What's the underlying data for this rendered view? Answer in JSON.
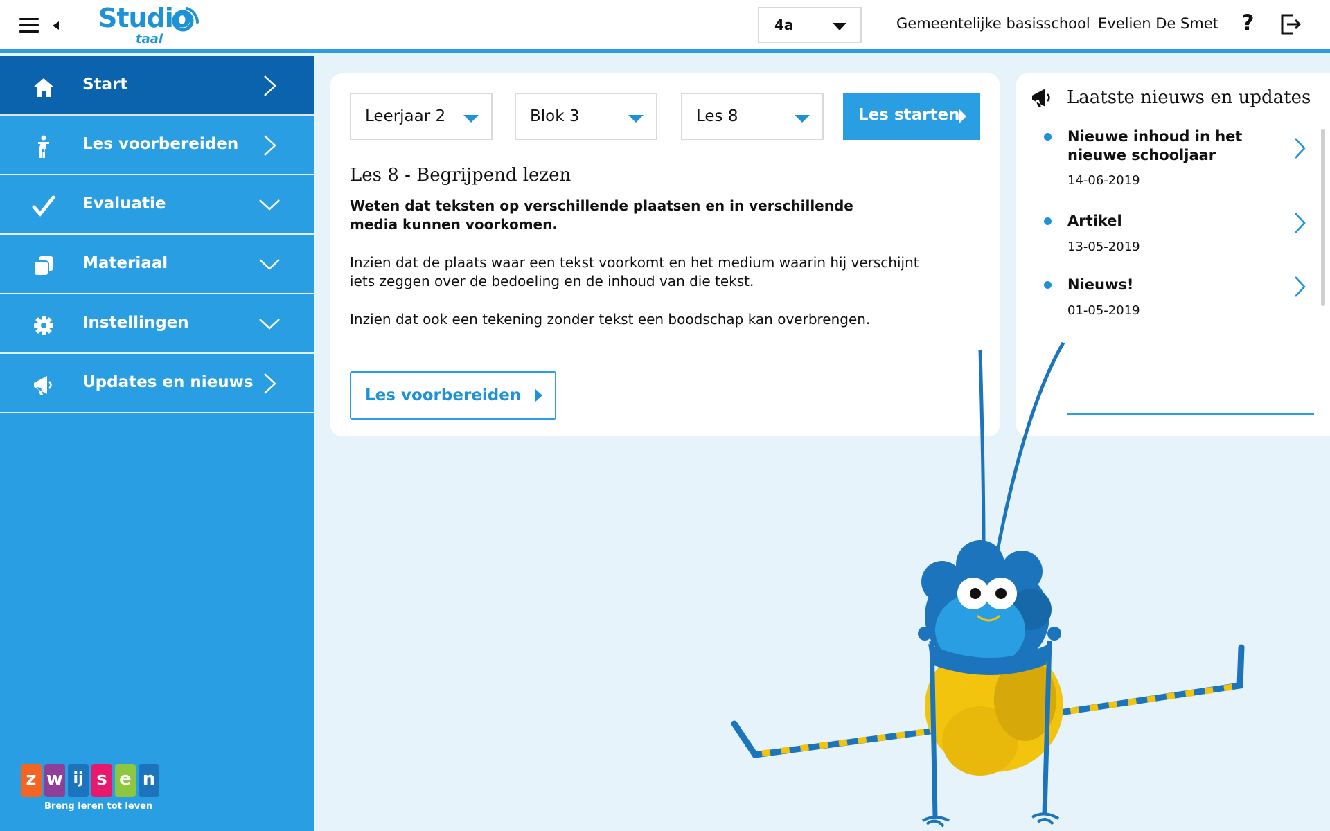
{
  "header": {
    "logo_text": "Studio",
    "logo_sub": "taal",
    "class_select": "4a",
    "school": "Gemeentelijke basisschool",
    "user": "Evelien De Smet",
    "help_symbol": "?"
  },
  "sidebar": {
    "items": [
      {
        "label": "Start",
        "icon": "home-icon",
        "chevron": "right",
        "active": true
      },
      {
        "label": "Les voorbereiden",
        "icon": "person-icon",
        "chevron": "right"
      },
      {
        "label": "Evaluatie",
        "icon": "checkmark-icon",
        "chevron": "down"
      },
      {
        "label": "Materiaal",
        "icon": "copies-icon",
        "chevron": "down"
      },
      {
        "label": "Instellingen",
        "icon": "gear-icon",
        "chevron": "down"
      },
      {
        "label": "Updates en nieuws",
        "icon": "megaphone-icon",
        "chevron": "right"
      }
    ],
    "brand": {
      "letters": [
        "z",
        "w",
        "ij",
        "s",
        "e",
        "n"
      ],
      "tagline": "Breng leren tot leven"
    }
  },
  "lesson": {
    "year_select": "Leerjaar 2",
    "block_select": "Blok 3",
    "lesson_select": "Les 8",
    "start_label": "Les starten",
    "title": "Les 8 - Begrijpend lezen",
    "goal": "Weten dat teksten op verschillende plaatsen en in verschillende media kunnen voorkomen.",
    "paragraph1": "Inzien dat de plaats waar een tekst voorkomt en het medium waarin hij verschijnt iets zeggen over de bedoeling en de inhoud van die tekst.",
    "paragraph2": "Inzien dat ook een tekening zonder tekst een boodschap kan overbrengen.",
    "prepare_label": "Les voorbereiden"
  },
  "news": {
    "title": "Laatste nieuws en updates",
    "items": [
      {
        "title": "Nieuwe inhoud in het nieuwe schooljaar",
        "date": "14-06-2019"
      },
      {
        "title": "Artikel",
        "date": "13-05-2019"
      },
      {
        "title": "Nieuws!",
        "date": "01-05-2019"
      }
    ]
  },
  "colors": {
    "primary": "#2a9ee2",
    "active_nav": "#0b62ad",
    "background": "#e6f3fa",
    "brand_tiles": [
      "#f26522",
      "#8e3f97",
      "#1c75bc",
      "#e8186c",
      "#8dc63f",
      "#1c75bc"
    ]
  }
}
